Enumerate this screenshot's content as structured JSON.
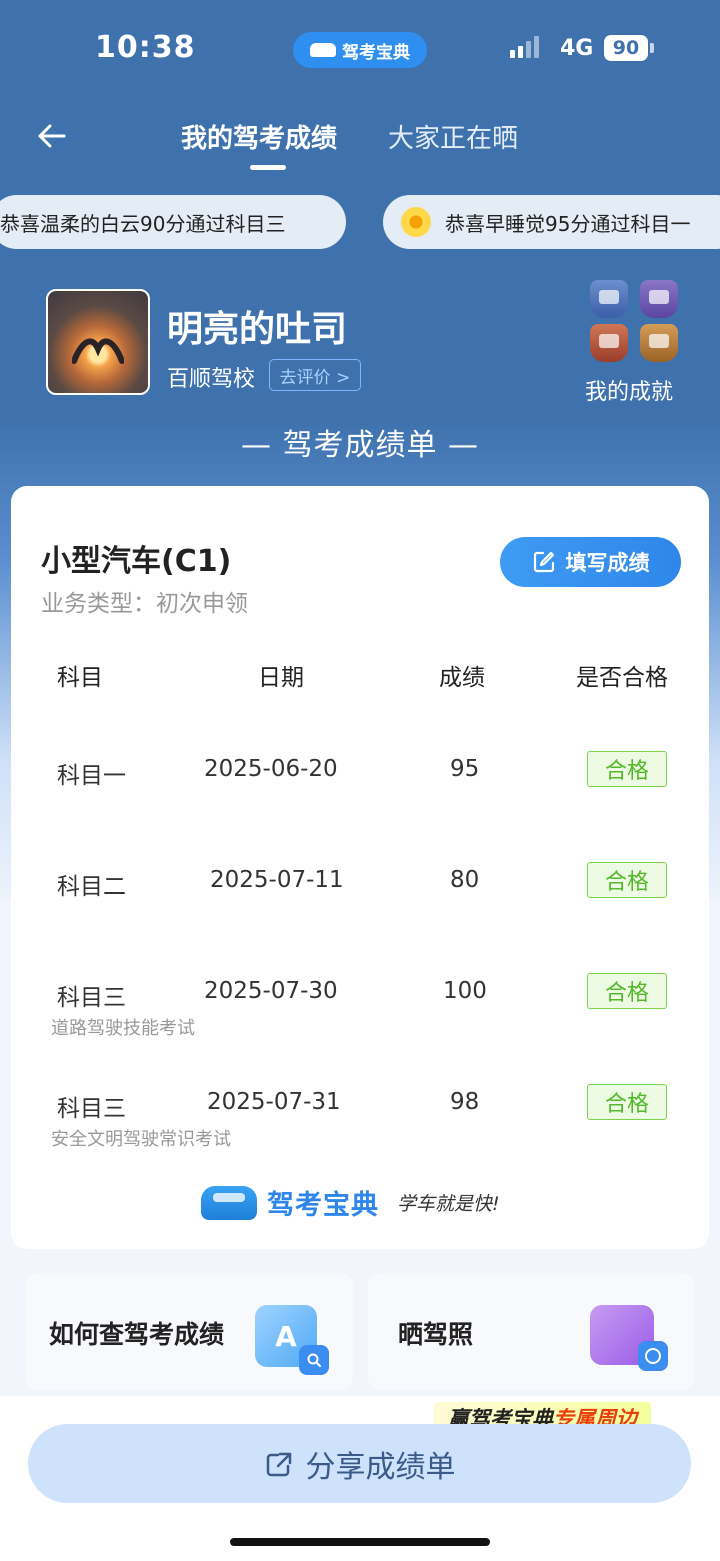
{
  "status_bar": {
    "time": "10:38",
    "app_name": "驾考宝典",
    "network": "4G",
    "battery": "90"
  },
  "nav": {
    "tabs": [
      {
        "label": "我的驾考成绩",
        "active": true
      },
      {
        "label": "大家正在晒",
        "active": false
      }
    ]
  },
  "ticker": [
    "恭喜温柔的白云90分通过科目三",
    "恭喜早睡觉95分通过科目一"
  ],
  "profile": {
    "username": "明亮的吐司",
    "school": "百顺驾校",
    "evaluate_label": "去评价 >",
    "achievements_label": "我的成就"
  },
  "sheet_title": "— 驾考成绩单 —",
  "card": {
    "vehicle": "小型汽车(C1)",
    "business_type": "业务类型：初次申领",
    "fill_button": "填写成绩",
    "headers": [
      "科目",
      "日期",
      "成绩",
      "是否合格"
    ],
    "rows": [
      {
        "subject": "科目一",
        "date": "2025-06-20",
        "score": "95",
        "result": "合格",
        "note": ""
      },
      {
        "subject": "科目二",
        "date": "2025-07-11",
        "score": "80",
        "result": "合格",
        "note": ""
      },
      {
        "subject": "科目三",
        "date": "2025-07-30",
        "score": "100",
        "result": "合格",
        "note": "道路驾驶技能考试"
      },
      {
        "subject": "科目三",
        "date": "2025-07-31",
        "score": "98",
        "result": "合格",
        "note": "安全文明驾驶常识考试"
      }
    ],
    "brand_name": "驾考宝典",
    "brand_slogan": "学车就是快!"
  },
  "features": [
    {
      "label": "如何查驾考成绩",
      "icon": "A"
    },
    {
      "label": "晒驾照",
      "icon": ""
    }
  ],
  "promo": {
    "text_part1": "赢驾考宝典",
    "text_part2": "专属周边"
  },
  "share_button": "分享成绩单",
  "colors": {
    "header_blue": "#3f72ad",
    "accent_blue": "#2f86ea",
    "pass_green": "#54b92a"
  }
}
